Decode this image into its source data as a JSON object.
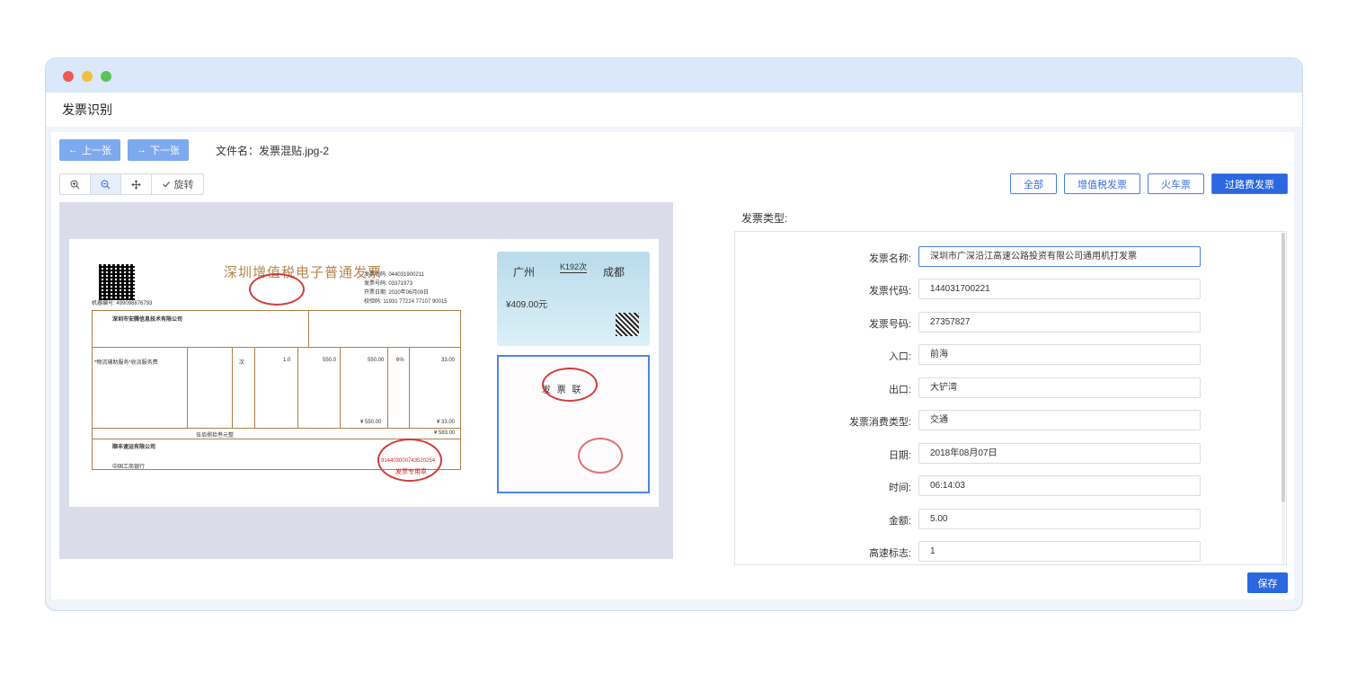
{
  "window": {
    "title": "发票识别"
  },
  "nav": {
    "prev_label": "上一张",
    "next_label": "下一张",
    "prev_icon": "arrow-left-icon",
    "next_icon": "arrow-right-icon"
  },
  "file": {
    "label": "文件名：发票混贴.jpg-2"
  },
  "toolbar": {
    "rotate_label": "旋转",
    "tools": [
      "zoom-in-icon",
      "zoom-out-icon",
      "move-icon",
      "check-icon"
    ]
  },
  "type_filter": {
    "buttons": [
      "全部",
      "增值税发票",
      "火车票",
      "过路费发票"
    ],
    "active": "过路费发票"
  },
  "form": {
    "caption": "发票类型:",
    "fields": [
      {
        "label": "发票名称:",
        "value": "深圳市广深沿江高速公路投资有限公司通用机打发票"
      },
      {
        "label": "发票代码:",
        "value": "144031700221"
      },
      {
        "label": "发票号码:",
        "value": "27357827"
      },
      {
        "label": "入口:",
        "value": "前海"
      },
      {
        "label": "出口:",
        "value": "大铲湾"
      },
      {
        "label": "发票消费类型:",
        "value": "交通"
      },
      {
        "label": "日期:",
        "value": "2018年08月07日"
      },
      {
        "label": "时间:",
        "value": "06:14:03"
      },
      {
        "label": "金额:",
        "value": "5.00"
      },
      {
        "label": "高速标志:",
        "value": "1"
      }
    ],
    "save_label": "保存"
  },
  "preview": {
    "vat_invoice": {
      "title": "深圳增值税电子普通发票",
      "code_label": "发票代码: 044031900211",
      "number_label": "发票号码: 03371973",
      "date_label": "开票日期: 2020年06月09日",
      "check_label": "校验码: 11931 77224 77107 90015",
      "machine_no": "机器编号: 499098876793",
      "buyer": "深圳市安腾信息技术有限公司",
      "item": "*物流辅助服务*收派服务费",
      "unit": "次",
      "qty": "1.0",
      "price": "550.0",
      "amount": "550.00",
      "tax_rate": "6%",
      "tax": "33.00",
      "total_amount": "¥ 550.00",
      "total_tax": "¥ 33.00",
      "total_cn": "伍佰捌拾叁元整",
      "total_num": "¥ 583.00",
      "seller": "顺丰速运有限公司",
      "seller_bank": "中国工商银行",
      "seal_no": "914403000743520254",
      "seal_text": "发票专用章"
    },
    "train_ticket": {
      "from": "广州",
      "to": "成都",
      "train_no": "K192次",
      "price": "¥409.00元"
    },
    "toll_ticket": {
      "title": "发 票 联"
    }
  }
}
